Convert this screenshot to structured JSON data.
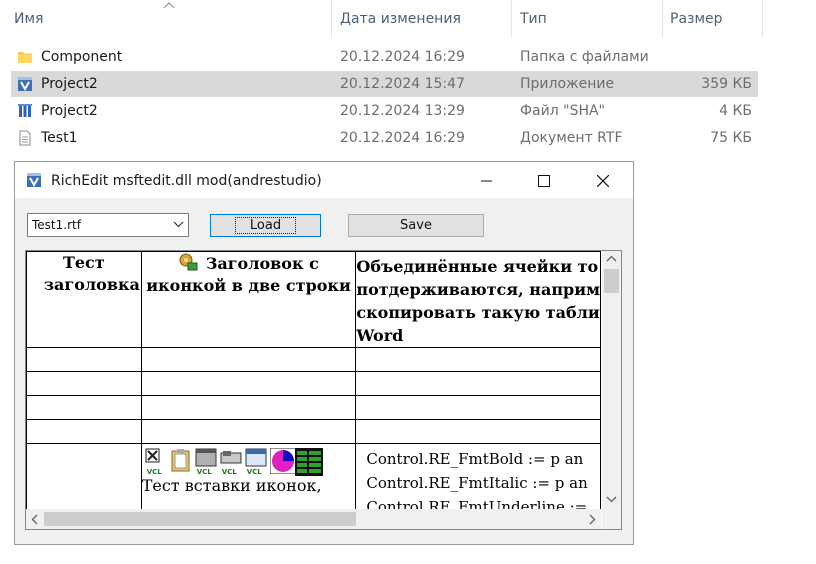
{
  "explorer": {
    "columns": {
      "name": "Имя",
      "date": "Дата изменения",
      "type": "Тип",
      "size": "Размер"
    },
    "files": [
      {
        "name": "Component",
        "date": "20.12.2024 16:29",
        "type": "Папка с файлами",
        "size": "",
        "icon": "folder-icon",
        "selected": false
      },
      {
        "name": "Project2",
        "date": "20.12.2024 15:47",
        "type": "Приложение",
        "size": "359 КБ",
        "icon": "app-icon",
        "selected": true
      },
      {
        "name": "Project2",
        "date": "20.12.2024 13:29",
        "type": "Файл \"SHA\"",
        "size": "4 КБ",
        "icon": "delphi-icon",
        "selected": false
      },
      {
        "name": "Test1",
        "date": "20.12.2024 16:29",
        "type": "Документ RTF",
        "size": "75 КБ",
        "icon": "rtf-document-icon",
        "selected": false
      }
    ]
  },
  "window": {
    "title": "RichEdit msftedit.dll mod(andrestudio)",
    "combo_value": "Test1.rtf",
    "load_label": "Load",
    "save_label": "Save"
  },
  "document": {
    "header": {
      "col1": "Тест заголовка",
      "col2": "Заголовок с иконкой в две строки",
      "col3_lines": [
        "Объединённые ячейки то",
        "потдерживаются, наприм",
        "скопировать такую табли",
        "Word"
      ]
    },
    "caption": "Тест вставки иконок,",
    "code_lines": [
      "Control.RE_FmtBold := p an",
      "Control.RE_FmtItalic := p an",
      "Control.RE_FmtUnderline :="
    ],
    "icon_badge": "VCL"
  }
}
